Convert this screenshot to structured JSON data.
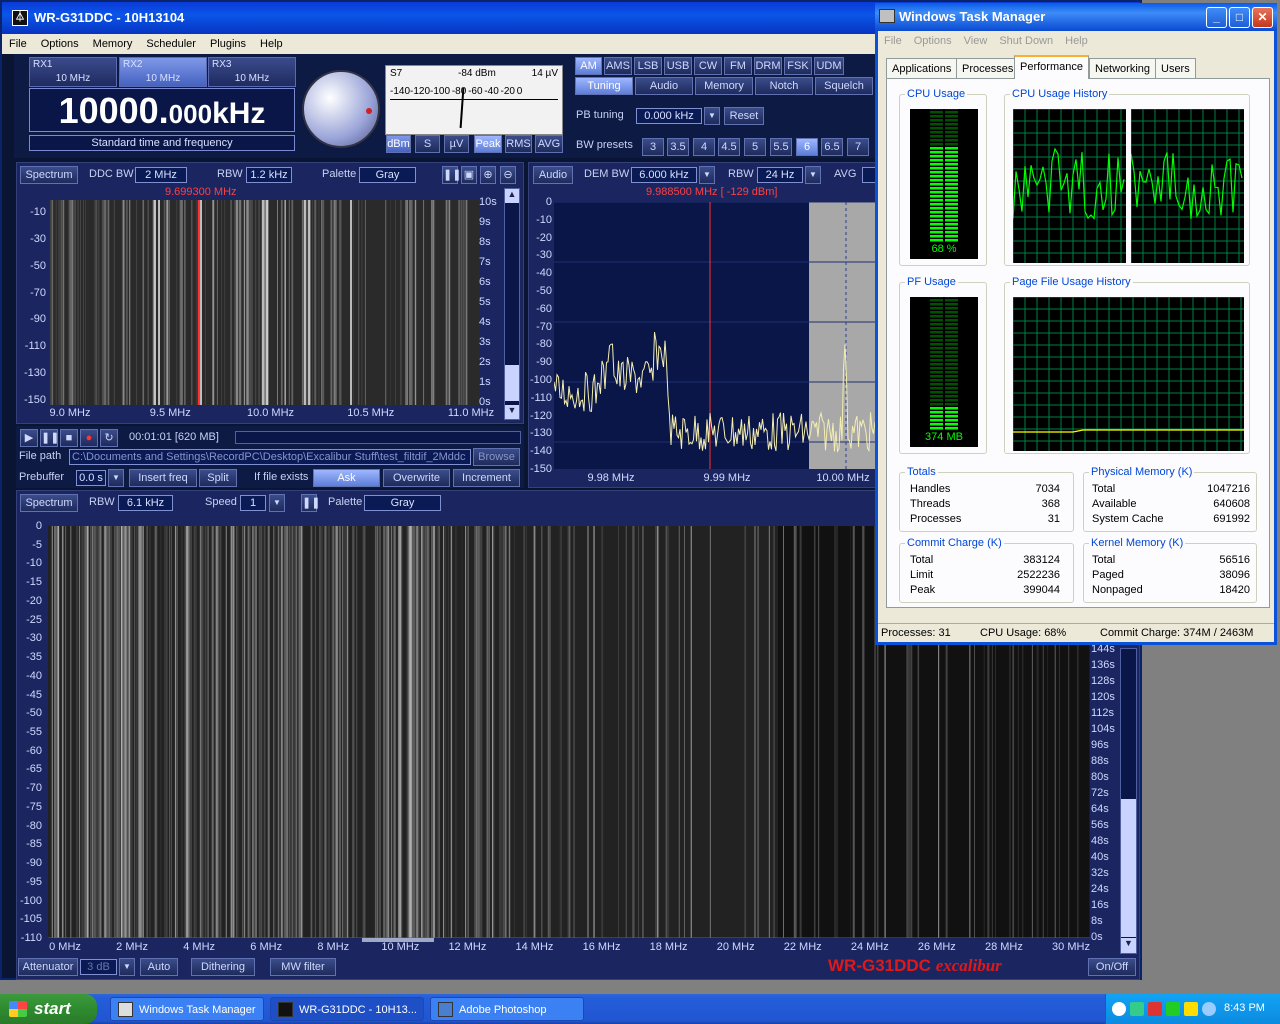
{
  "wr": {
    "title": "WR-G31DDC - 10H13104",
    "menu": [
      "File",
      "Options",
      "Memory",
      "Scheduler",
      "Plugins",
      "Help"
    ],
    "rx": [
      {
        "name": "RX1",
        "freq": "10 MHz"
      },
      {
        "name": "RX2",
        "freq": "10 MHz"
      },
      {
        "name": "RX3",
        "freq": "10 MHz"
      }
    ],
    "frequency_main": "10000.",
    "frequency_small": "000",
    "frequency_unit": "kHz",
    "station": "Standard time and frequency",
    "smeter": {
      "s": "S7",
      "dbm": "-84 dBm",
      "uv": "14 µV",
      "scale": [
        "-140",
        "-120",
        "-100",
        "-80",
        "-60",
        "-40",
        "-20",
        "0"
      ]
    },
    "meter_buttons": [
      "dBm",
      "S",
      "µV",
      "Peak",
      "RMS",
      "AVG"
    ],
    "modes": [
      "AM",
      "AMS",
      "LSB",
      "USB",
      "CW",
      "FM",
      "DRM",
      "FSK",
      "UDM"
    ],
    "tabs": [
      "Tuning",
      "Audio",
      "Memory",
      "Notch",
      "Squelch"
    ],
    "pb_label": "PB tuning",
    "pb_value": "0.000 kHz",
    "reset": "Reset",
    "bw_label": "BW presets",
    "bw_presets": [
      "3",
      "3.5",
      "4",
      "4.5",
      "5",
      "5.5",
      "6",
      "6.5",
      "7"
    ],
    "ddc": {
      "spectrum": "Spectrum",
      "bw_label": "DDC BW",
      "bw": "2 MHz",
      "rbw_label": "RBW",
      "rbw": "1.2 kHz",
      "palette_label": "Palette",
      "palette": "Gray",
      "marker": "9.699300 MHz",
      "yticks": [
        "-10",
        "-30",
        "-50",
        "-70",
        "-90",
        "-110",
        "-130",
        "-150"
      ],
      "tticks": [
        "10s",
        "9s",
        "8s",
        "7s",
        "6s",
        "5s",
        "4s",
        "3s",
        "2s",
        "1s",
        "0s"
      ],
      "xticks": [
        "9.0 MHz",
        "9.5 MHz",
        "10.0 MHz",
        "10.5 MHz",
        "11.0 MHz"
      ]
    },
    "audio": {
      "label": "Audio",
      "dem_label": "DEM BW",
      "dem": "6.000 kHz",
      "rbw_label": "RBW",
      "rbw": "24 Hz",
      "avg_label": "AVG",
      "marker": "9.988500 MHz [ -129 dBm]",
      "yticks": [
        "0",
        "-10",
        "-20",
        "-30",
        "-40",
        "-50",
        "-60",
        "-70",
        "-80",
        "-90",
        "-100",
        "-110",
        "-120",
        "-130",
        "-140",
        "-150"
      ],
      "xticks": [
        "9.98 MHz",
        "9.99 MHz",
        "10.00 MHz"
      ]
    },
    "recorder": {
      "time": "00:01:01 [620 MB]",
      "path_label": "File path",
      "path": "C:\\Documents and Settings\\RecordPC\\Desktop\\Excalibur Stuff\\test_filtdif_2Mddc",
      "browse": "Browse",
      "prebuffer_label": "Prebuffer",
      "prebuffer": "0.0 s",
      "insert": "Insert freq",
      "split": "Split",
      "exists_label": "If file exists",
      "ask": "Ask",
      "overwrite": "Overwrite",
      "increment": "Increment"
    },
    "wide": {
      "spectrum": "Spectrum",
      "rbw_label": "RBW",
      "rbw": "6.1 kHz",
      "speed_label": "Speed",
      "speed": "1",
      "palette_label": "Palette",
      "palette": "Gray",
      "yticks": [
        "0",
        "-5",
        "-10",
        "-15",
        "-20",
        "-25",
        "-30",
        "-35",
        "-40",
        "-45",
        "-50",
        "-55",
        "-60",
        "-65",
        "-70",
        "-75",
        "-80",
        "-85",
        "-90",
        "-95",
        "-100",
        "-105",
        "-110"
      ],
      "tticks": [
        "144s",
        "136s",
        "128s",
        "120s",
        "112s",
        "104s",
        "96s",
        "88s",
        "80s",
        "72s",
        "64s",
        "56s",
        "48s",
        "40s",
        "32s",
        "24s",
        "16s",
        "8s",
        "0s"
      ],
      "xticks": [
        "0 MHz",
        "2 MHz",
        "4 MHz",
        "6 MHz",
        "8 MHz",
        "10 MHz",
        "12 MHz",
        "14 MHz",
        "16 MHz",
        "18 MHz",
        "20 MHz",
        "22 MHz",
        "24 MHz",
        "26 MHz",
        "28 MHz",
        "30 MHz"
      ]
    },
    "bottom": {
      "attenuator": "Attenuator",
      "att_value": "3 dB",
      "auto": "Auto",
      "dithering": "Dithering",
      "mw": "MW filter",
      "brand": "WR-G31DDC",
      "brand2": "excalibur",
      "onoff": "On/Off"
    }
  },
  "tm": {
    "title": "Windows Task Manager",
    "menu": [
      "File",
      "Options",
      "View",
      "Shut Down",
      "Help"
    ],
    "tabs": [
      "Applications",
      "Processes",
      "Performance",
      "Networking",
      "Users"
    ],
    "cpu_usage_label": "CPU Usage",
    "cpu_usage": "68 %",
    "cpu_usage_fraction": 0.68,
    "cpu_history_label": "CPU Usage History",
    "pf_usage_label": "PF Usage",
    "pf_usage": "374 MB",
    "pf_usage_fraction": 0.15,
    "pf_history_label": "Page File Usage History",
    "totals": {
      "label": "Totals",
      "rows": [
        [
          "Handles",
          "7034"
        ],
        [
          "Threads",
          "368"
        ],
        [
          "Processes",
          "31"
        ]
      ]
    },
    "physical": {
      "label": "Physical Memory (K)",
      "rows": [
        [
          "Total",
          "1047216"
        ],
        [
          "Available",
          "640608"
        ],
        [
          "System Cache",
          "691992"
        ]
      ]
    },
    "commit": {
      "label": "Commit Charge (K)",
      "rows": [
        [
          "Total",
          "383124"
        ],
        [
          "Limit",
          "2522236"
        ],
        [
          "Peak",
          "399044"
        ]
      ]
    },
    "kernel": {
      "label": "Kernel Memory (K)",
      "rows": [
        [
          "Total",
          "56516"
        ],
        [
          "Paged",
          "38096"
        ],
        [
          "Nonpaged",
          "18420"
        ]
      ]
    },
    "status": {
      "processes": "Processes: 31",
      "cpu": "CPU Usage: 68%",
      "commit": "Commit Charge: 374M / 2463M"
    }
  },
  "taskbar": {
    "start": "start",
    "tasks": [
      "Windows Task Manager",
      "WR-G31DDC - 10H13...",
      "Adobe Photoshop"
    ],
    "clock": "8:43 PM"
  },
  "colors": {
    "accent": "#0a53d8",
    "spectrum_trace": "#f4eeb0",
    "marker": "#ff3030",
    "cpu_graph": "#00ff00"
  }
}
